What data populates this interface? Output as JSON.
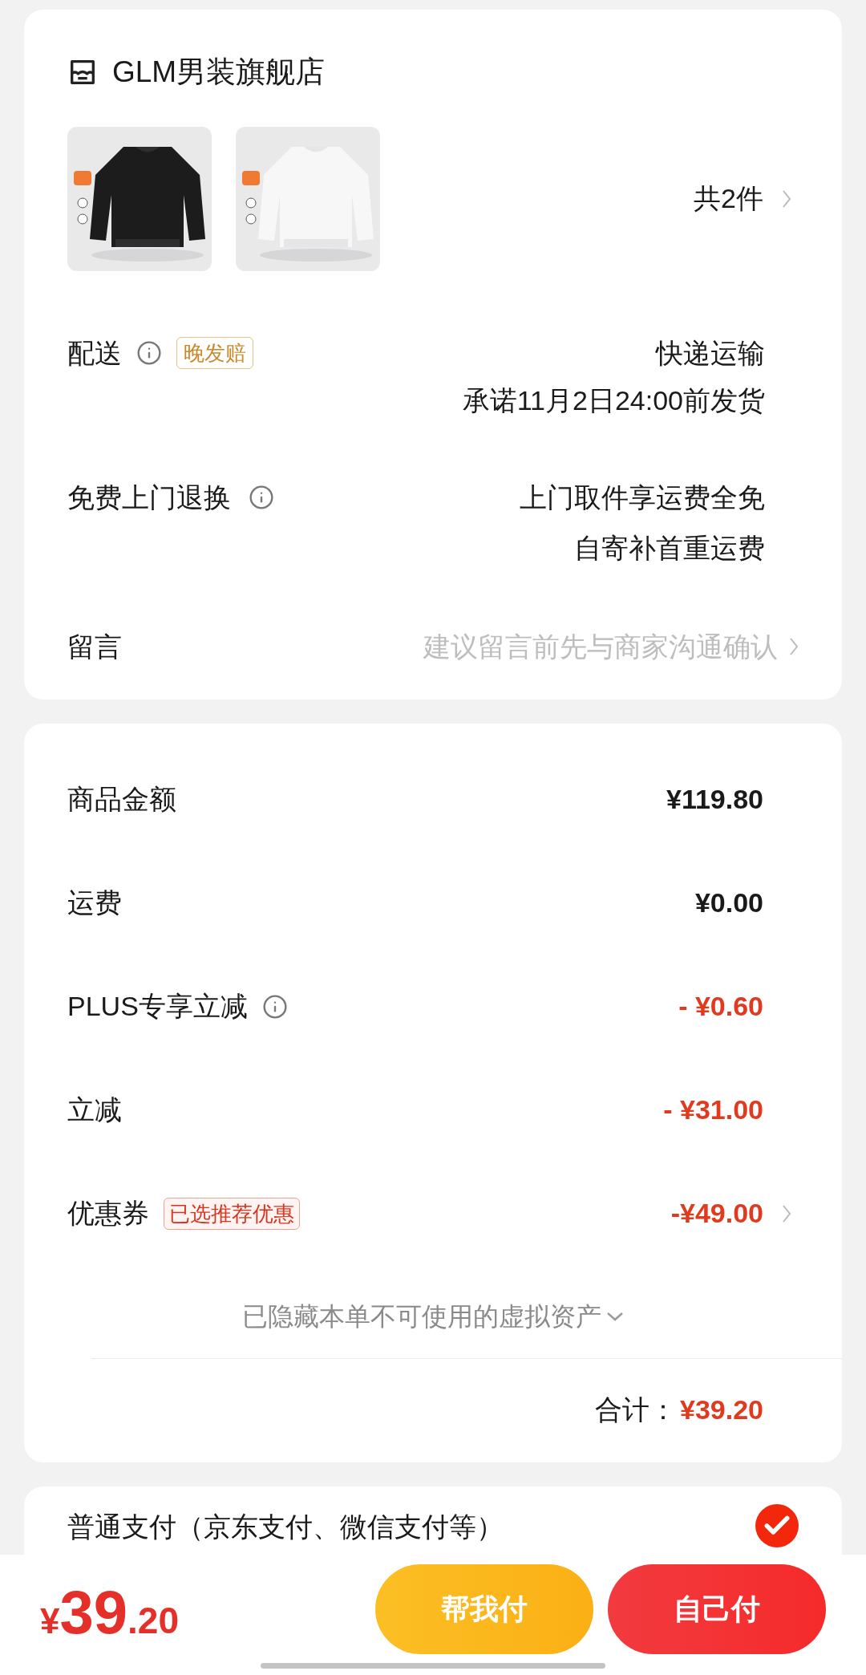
{
  "store": {
    "name": "GLM男装旗舰店"
  },
  "items": {
    "count": "共2件"
  },
  "delivery": {
    "label": "配送",
    "info": true,
    "badge": "晚发赔",
    "values": [
      "快递运输",
      "承诺11月2日24:00前发货"
    ]
  },
  "returns": {
    "label": "免费上门退换",
    "info": true,
    "values": [
      "上门取件享运费全免",
      "自寄补首重运费"
    ]
  },
  "message": {
    "label": "留言",
    "placeholder": "建议留言前先与商家沟通确认"
  },
  "amounts": [
    {
      "kind": "charge",
      "label": "商品金额",
      "info": false,
      "value": "¥119.80",
      "chevron": false
    },
    {
      "kind": "charge",
      "label": "运费",
      "info": false,
      "value": "¥0.00",
      "chevron": false
    },
    {
      "kind": "discount",
      "label": "PLUS专享立减",
      "info": true,
      "value": "- ¥0.60",
      "chevron": false
    },
    {
      "kind": "discount",
      "label": "立减",
      "info": false,
      "value": "- ¥31.00",
      "chevron": false
    },
    {
      "kind": "discount",
      "label": "优惠券",
      "info": false,
      "badge": "已选推荐优惠",
      "value": "-¥49.00",
      "chevron": true
    }
  ],
  "hidden_assets": {
    "label": "已隐藏本单不可使用的虚拟资产",
    "expanded": false
  },
  "total": {
    "label": "合计：",
    "value": "¥39.20"
  },
  "payment": {
    "label": "普通支付（京东支付、微信支付等）",
    "selected": true
  },
  "bottom_bar": {
    "currency": "¥",
    "integer": "39",
    "decimal": ".20",
    "buttons": [
      {
        "kind": "secondary",
        "label": "帮我付"
      },
      {
        "kind": "primary",
        "label": "自己付"
      }
    ]
  }
}
